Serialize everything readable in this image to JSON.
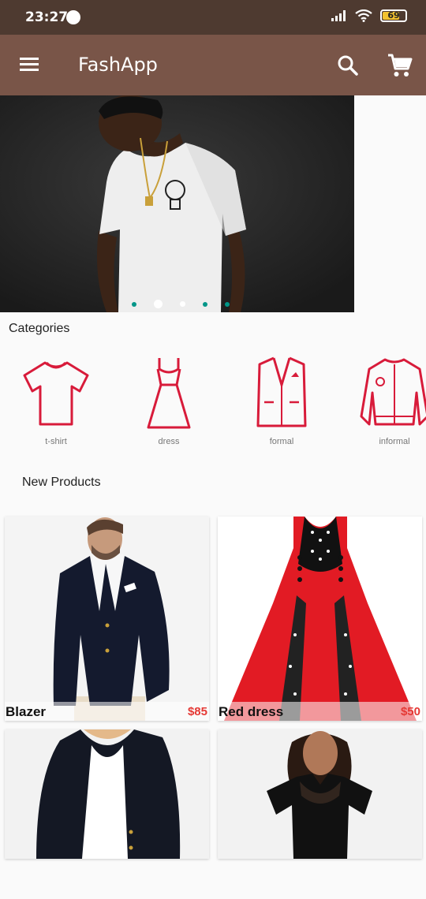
{
  "status": {
    "time": "23:27",
    "battery": "69"
  },
  "appbar": {
    "title": "FashApp"
  },
  "carousel": {
    "slide_count": 5,
    "active_index": 1
  },
  "categories": {
    "title": "Categories",
    "items": [
      {
        "label": "t-shirt",
        "icon": "tshirt-icon"
      },
      {
        "label": "dress",
        "icon": "dress-icon"
      },
      {
        "label": "formal",
        "icon": "blazer-icon"
      },
      {
        "label": "informal",
        "icon": "jacket-icon"
      }
    ]
  },
  "new_products": {
    "title": "New Products",
    "items": [
      {
        "name": "Blazer",
        "price": "$85"
      },
      {
        "name": "Red dress",
        "price": "$50"
      },
      {
        "name": "",
        "price": ""
      },
      {
        "name": "",
        "price": ""
      }
    ]
  },
  "colors": {
    "appbar": "#795548",
    "statusbar": "#4e3a30",
    "icon_red": "#d81b3a",
    "price": "#e53935",
    "dot_accent": "#009688"
  }
}
